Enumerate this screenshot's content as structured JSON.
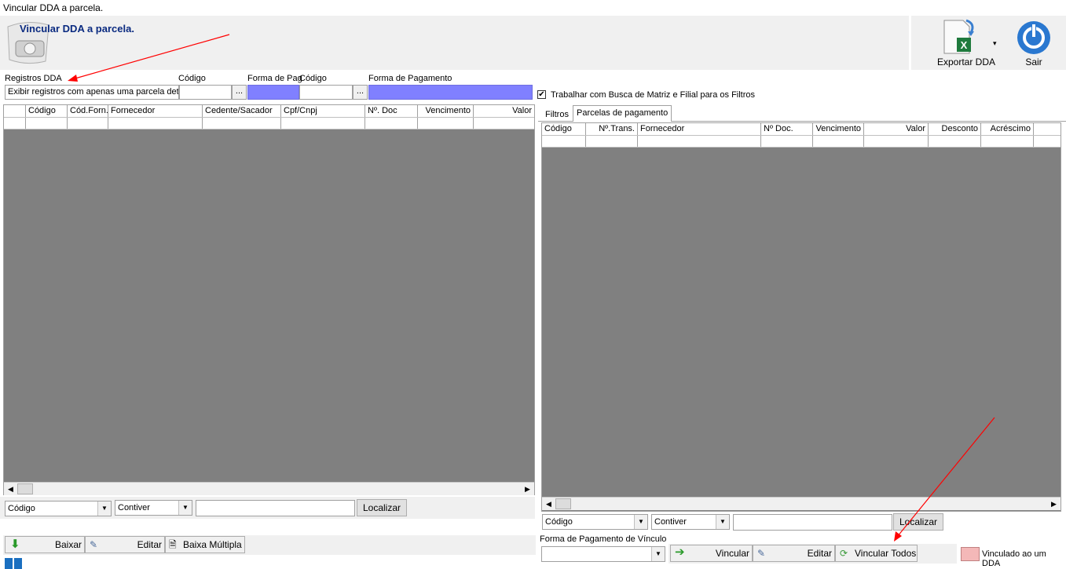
{
  "window": {
    "title": "Vincular DDA a parcela."
  },
  "header": {
    "title": "Vincular DDA a parcela."
  },
  "toolbar": {
    "export_label": "Exportar DDA",
    "exit_label": "Sair"
  },
  "filters": {
    "registros_label": "Registros DDA",
    "registros_value": "Exibir registros com apenas uma parcela dete",
    "codigo_label": "Código",
    "forma_pag_label": "Forma de Pag",
    "codigo2_label": "Código",
    "forma_pagamento_label": "Forma de Pagamento",
    "ellipsis": "..."
  },
  "left_grid": {
    "columns": [
      "Código",
      "Cód.Forn.",
      "Fornecedor",
      "Cedente/Sacador",
      "Cpf/Cnpj",
      "Nº. Doc",
      "Vencimento",
      "Valor"
    ]
  },
  "left_search": {
    "field": "Código",
    "mode": "Contiver",
    "value": "",
    "button": "Localizar"
  },
  "left_actions": {
    "baixar": "Baixar",
    "editar": "Editar",
    "baixa_multipla": "Baixa Múltipla"
  },
  "right": {
    "checkbox_label": "Trabalhar com Busca de Matriz e Filial para os Filtros",
    "checkbox_checked": true,
    "tabs": [
      "Filtros",
      "Parcelas de pagamento"
    ],
    "grid_columns": [
      "Código",
      "Nº.Trans.",
      "Fornecedor",
      "Nº Doc.",
      "Vencimento",
      "Valor",
      "Desconto",
      "Acréscimo"
    ],
    "search": {
      "field": "Código",
      "mode": "Contiver",
      "value": "",
      "button": "Localizar"
    },
    "forma_vinculo_label": "Forma de Pagamento de Vínculo",
    "actions": {
      "vincular": "Vincular",
      "editar": "Editar",
      "vincular_todos": "Vincular Todos"
    },
    "legend_label": "Vinculado ao um DDA",
    "legend_color": "#f4b8b8"
  },
  "colors": {
    "grid_bg": "#808080",
    "highlight_input": "#8080ff",
    "annotation_arrow": "#ff0000"
  }
}
